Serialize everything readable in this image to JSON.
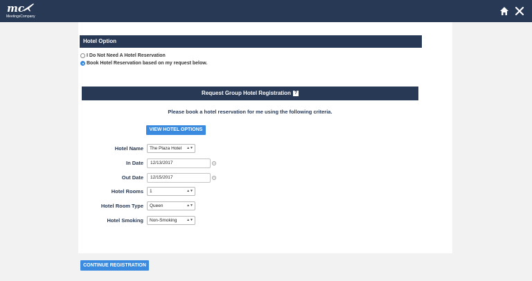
{
  "header": {
    "logo_text": "mc",
    "logo_subtext": "MeetingsCompany",
    "home_icon": "home-icon",
    "close_icon": "close-icon"
  },
  "hotel_option": {
    "title": "Hotel Option",
    "options": [
      {
        "label": "I Do Not Need A Hotel Reservation",
        "checked": false
      },
      {
        "label": "Book Hotel Reservation based on my request below.",
        "checked": true
      }
    ]
  },
  "group_registration": {
    "title": "Request Group Hotel Registration",
    "help_icon": "?",
    "instruction": "Please book a hotel reservation for me using the following criteria.",
    "view_button": "VIEW HOTEL OPTIONS",
    "fields": {
      "hotel_name": {
        "label": "Hotel Name",
        "value": "The Plaza Hotel"
      },
      "in_date": {
        "label": "In Date",
        "value": "12/13/2017"
      },
      "out_date": {
        "label": "Out Date",
        "value": "12/15/2017"
      },
      "hotel_rooms": {
        "label": "Hotel Rooms",
        "value": "1"
      },
      "room_type": {
        "label": "Hotel Room Type",
        "value": "Queen"
      },
      "smoking": {
        "label": "Hotel Smoking",
        "value": "Non-Smoking"
      }
    }
  },
  "continue_button": "CONTINUE REGISTRATION",
  "colors": {
    "navy": "#283955",
    "accent_blue": "#3a8be0",
    "page_bg": "#f2f2f2"
  }
}
